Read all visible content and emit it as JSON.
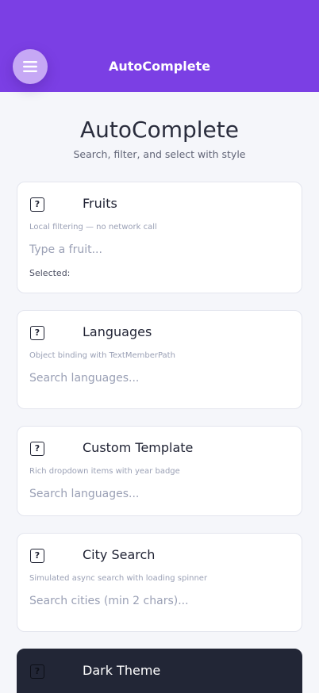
{
  "header": {
    "title": "AutoComplete",
    "menu_icon": "hamburger-menu-icon",
    "color": "#7b3fe4"
  },
  "page": {
    "title": "AutoComplete",
    "subtitle": "Search, filter, and select with style"
  },
  "cards": [
    {
      "title": "Fruits",
      "icon": "help-icon",
      "description": "Local filtering — no network call",
      "placeholder": "Type a fruit...",
      "selected_label": "Selected:"
    },
    {
      "title": "Languages",
      "icon": "help-icon",
      "description": "Object binding with TextMemberPath",
      "placeholder": "Search languages..."
    },
    {
      "title": "Custom Template",
      "icon": "help-icon",
      "description": "Rich dropdown items with year badge",
      "placeholder": "Search languages..."
    },
    {
      "title": "City Search",
      "icon": "help-icon",
      "description": "Simulated async search with loading spinner",
      "placeholder": "Search cities (min 2 chars)..."
    },
    {
      "title": "Dark Theme",
      "icon": "help-icon",
      "theme": "dark"
    }
  ]
}
